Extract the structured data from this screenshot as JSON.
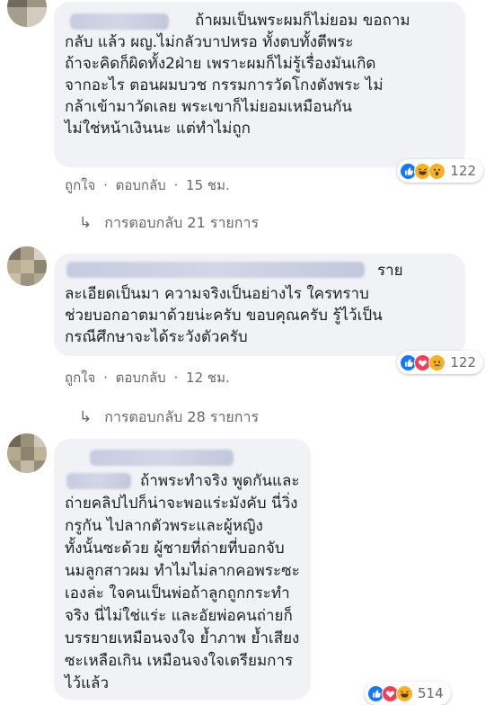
{
  "comments": [
    {
      "text": "ถ้าผมเป็นพระผมก็ไม่ยอม ขอถามกลับ แล้ว ผญ.ไม่กลัวบาปหรอ ทั้งตบทั้งตีพระ ถ้าจะคิดก็ผิดทั้ง2ฝ่าย เพราะผมก็ไม่รู้เรื่องมันเกิดจากอะไร ตอนผมบวช กรรมการวัดโกงตังพระ ไม่กล้าเข้ามาวัดเลย พระเขาก็ไม่ยอมเหมือนกัน ไม่ใช่หน้าเงินนะ แต่ทำไม่ถูก",
      "line1": "ถ้าผมเป็นพระผมก็ไม่ยอม ขอถาม",
      "line2": "กลับ แล้ว ผญ.ไม่กลัวบาปหรอ ทั้งตบทั้งตีพระ",
      "line3": "ถ้าจะคิดก็ผิดทั้ง2ฝ่าย เพราะผมก็ไม่รู้เรื่องมันเกิด",
      "line4": "จากอะไร ตอนผมบวช กรรมการวัดโกงตังพระ ไม่",
      "line5": "กล้าเข้ามาวัดเลย พระเขาก็ไม่ยอมเหมือนกัน",
      "line6": "ไม่ใช่หน้าเงินนะ แต่ทำไม่ถูก",
      "reaction_count": "122",
      "reactions": [
        "like-icon",
        "haha-icon",
        "wow-icon"
      ],
      "like_label": "ถูกใจ",
      "reply_label": "ตอบกลับ",
      "time": "15 ชม.",
      "replies_label": "การตอบกลับ 21 รายการ"
    },
    {
      "line1": "ราย",
      "line2": "ละเอียดเป็นมา ความจริงเป็นอย่างไร ใครทราบ",
      "line3": "ช่วยบอกอาตมาด้วยน่ะครับ ขอบคุณครับ รู้ไว้เป็น",
      "line4": "กรณีศึกษาจะได้ระวังตัวครับ",
      "reaction_count": "122",
      "reactions": [
        "like-icon",
        "love-icon",
        "sad-icon"
      ],
      "like_label": "ถูกใจ",
      "reply_label": "ตอบกลับ",
      "time": "12 ชม.",
      "replies_label": "การตอบกลับ 28 รายการ"
    },
    {
      "line1": "ถ้าพระทำจริง พูดกันและ",
      "line2": "ถ่ายคลิปไปก็น่าจะพอแร่ะมังคับ นี่วิ่ง",
      "line3": "กรูกัน ไปลากตัวพระและผู้หญิง",
      "line4": "ทั้งนั้นซะด้วย ผู้ชายที่ถ่ายที่บอกจับ",
      "line5": "นมลูกสาวผม ทำไมไม่ลากคอพระซะ",
      "line6": "เองล่ะ ใจคนเป็นพ่อถ้าลูกถูกกระทำ",
      "line7": "จริง นี่ไม่ใช่แร่ะ และอัยพ่อคนถ่ายก็",
      "line8": "บรรยายเหมือนจงใจ ย้ำภาพ ย้ำเสียง",
      "line9": "ซะเหลือเกิน เหมือนจงใจเตรียมการ",
      "line10": "ไว้แล้ว",
      "reaction_count": "514",
      "reactions": [
        "like-icon",
        "love-icon",
        "haha-icon"
      ]
    }
  ],
  "colors": {
    "bubble": "#f0f2f5",
    "secondary_text": "#65676b",
    "like_blue": "#1877f2",
    "love_red": "#f33e58",
    "emoji_yellow": "#f7b125"
  }
}
